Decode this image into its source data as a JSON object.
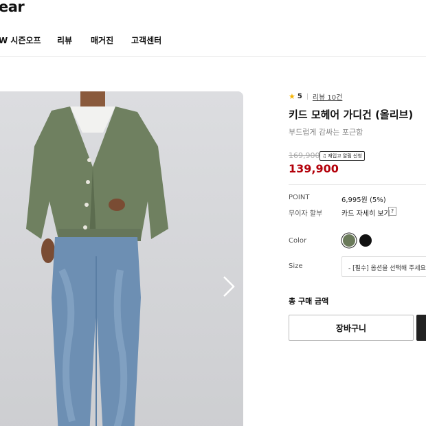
{
  "header": {
    "logo_text": "ear",
    "nav": [
      {
        "label": "W 시즌오프"
      },
      {
        "label": "리뷰"
      },
      {
        "label": "매거진"
      },
      {
        "label": "고객센터"
      }
    ]
  },
  "product": {
    "rating": "5",
    "review_link": "리뷰 10건",
    "title": "키드 모헤어 가디건 (올리브)",
    "subtitle": "부드럽게 감싸는 포근함",
    "original_price": "169,900",
    "restock_label": "재입고 알림 신청",
    "sale_price": "139,900",
    "point_label": "POINT",
    "point_value": "6,995원 (5%)",
    "installment_label": "무이자 할부",
    "installment_value": "카드 자세히 보기",
    "help_label": "?",
    "color_label": "Color",
    "colors": [
      {
        "name": "olive",
        "hex": "#6a7a5a",
        "selected": true
      },
      {
        "name": "black",
        "hex": "#111111",
        "selected": false
      }
    ],
    "size_label": "Size",
    "size_select": "- [필수] 옵션을 선택해 주세요 -",
    "total_label": "총 구매 금액",
    "cart_button": "장바구니"
  },
  "icons": {
    "star": "star-icon",
    "bell": "bell-icon",
    "next": "chevron-right-icon"
  },
  "colors": {
    "sale_red": "#b3000a",
    "star_yellow": "#f5b301",
    "buy_dark": "#222222"
  }
}
